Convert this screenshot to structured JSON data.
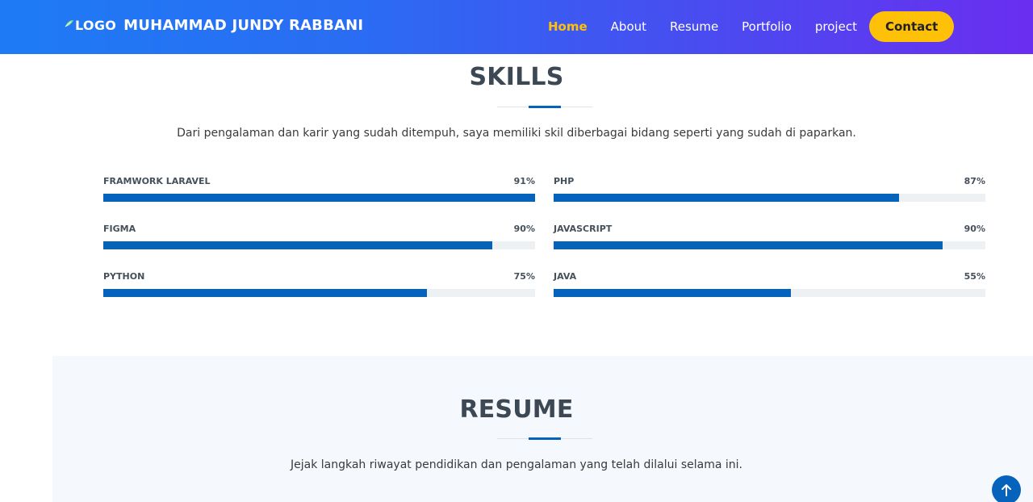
{
  "header": {
    "logo_text": "LOGO",
    "site_name": "MUHAMMAD JUNDY RABBANI",
    "nav": [
      {
        "label": "Home",
        "active": true
      },
      {
        "label": "About",
        "active": false
      },
      {
        "label": "Resume",
        "active": false
      },
      {
        "label": "Portfolio",
        "active": false
      },
      {
        "label": "project",
        "active": false
      }
    ],
    "cta_label": "Contact"
  },
  "skills": {
    "title": "SKILLS",
    "description": "Dari pengalaman dan karir yang sudah ditempuh, saya memiliki skil diberbagai bidang seperti yang sudah di paparkan.",
    "items": [
      {
        "name": "FRAMWORK LARAVEL",
        "percent_label": "91%",
        "fill": 1.0
      },
      {
        "name": "PHP",
        "percent_label": "87%",
        "fill": 0.8
      },
      {
        "name": "FIGMA",
        "percent_label": "90%",
        "fill": 0.9
      },
      {
        "name": "JAVASCRIPT",
        "percent_label": "90%",
        "fill": 0.9
      },
      {
        "name": "PYTHON",
        "percent_label": "75%",
        "fill": 0.75
      },
      {
        "name": "JAVA",
        "percent_label": "55%",
        "fill": 0.55
      }
    ]
  },
  "resume": {
    "title": "RESUME",
    "description": "Jejak langkah riwayat pendidikan dan pengalaman yang telah dilalui selama ini."
  },
  "back_to_top_icon": "arrow-up-icon",
  "colors": {
    "accent": "#0563bb",
    "cta": "#ffc107",
    "header_start": "#1e7bf5",
    "header_end": "#6a2ef0"
  }
}
